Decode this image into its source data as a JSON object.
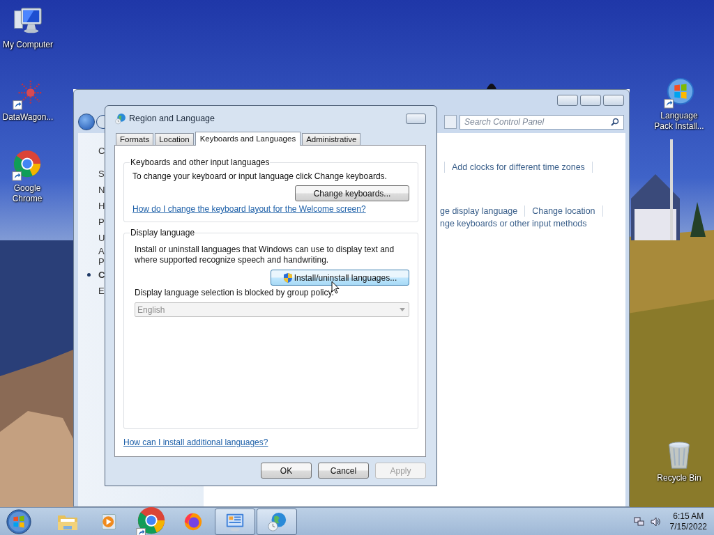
{
  "desktop": {
    "icons": [
      {
        "kind": "computer",
        "label": "My Computer"
      },
      {
        "kind": "starburst",
        "label": "DataWagon..."
      },
      {
        "kind": "chrome",
        "label": "Google Chrome"
      },
      {
        "kind": "globe",
        "label": "Language Pack Install..."
      },
      {
        "kind": "bin",
        "label": "Recycle Bin"
      }
    ]
  },
  "control_panel_window": {
    "search": {
      "placeholder": "Search Control Panel"
    },
    "sidebar_items": [
      {
        "text": "C",
        "selected": false
      },
      {
        "text": "S",
        "selected": false
      },
      {
        "text": "N",
        "selected": false
      },
      {
        "text": "H",
        "selected": false
      },
      {
        "text": "P",
        "selected": false
      },
      {
        "text": "U",
        "selected": false
      },
      {
        "text": "A\nP",
        "selected": false
      },
      {
        "text": "C",
        "selected": true
      },
      {
        "text": "E",
        "selected": false
      }
    ],
    "link_rows": [
      {
        "links": [
          "Add clocks for different time zones"
        ]
      },
      {
        "links": [
          "ge display language",
          "Change location"
        ]
      },
      {
        "links": [
          "nge keyboards or other input methods"
        ]
      }
    ]
  },
  "dialog": {
    "title": "Region and Language",
    "tabs": [
      {
        "label": "Formats",
        "selected": false
      },
      {
        "label": "Location",
        "selected": false
      },
      {
        "label": "Keyboards and Languages",
        "selected": true
      },
      {
        "label": "Administrative",
        "selected": false
      }
    ],
    "keyboards_group": {
      "title": "Keyboards and other input languages",
      "description": "To change your keyboard or input language click Change keyboards.",
      "button": "Change keyboards...",
      "link": "How do I change the keyboard layout for the Welcome screen?"
    },
    "display_group": {
      "title": "Display language",
      "description": "Install or uninstall languages that Windows can use to display text and where supported recognize speech and handwriting.",
      "button": {
        "label": "Install/uninstall languages...",
        "hover": true
      },
      "note": "Display language selection is blocked by group policy.",
      "dropdown": {
        "value": "English",
        "disabled": true
      }
    },
    "help_link": "How can I install additional languages?",
    "buttons": [
      {
        "label": "OK",
        "disabled": false
      },
      {
        "label": "Cancel",
        "disabled": false
      },
      {
        "label": "Apply",
        "disabled": true
      }
    ]
  },
  "taskbar": {
    "items": [
      {
        "kind": "folder",
        "active": false
      },
      {
        "kind": "media",
        "active": false
      },
      {
        "kind": "chrome",
        "active": false
      },
      {
        "kind": "firefox",
        "active": false
      },
      {
        "kind": "control-panel",
        "active": true
      },
      {
        "kind": "globe-clock",
        "active": true
      }
    ],
    "time": "6:15 AM",
    "date": "7/15/2022"
  }
}
